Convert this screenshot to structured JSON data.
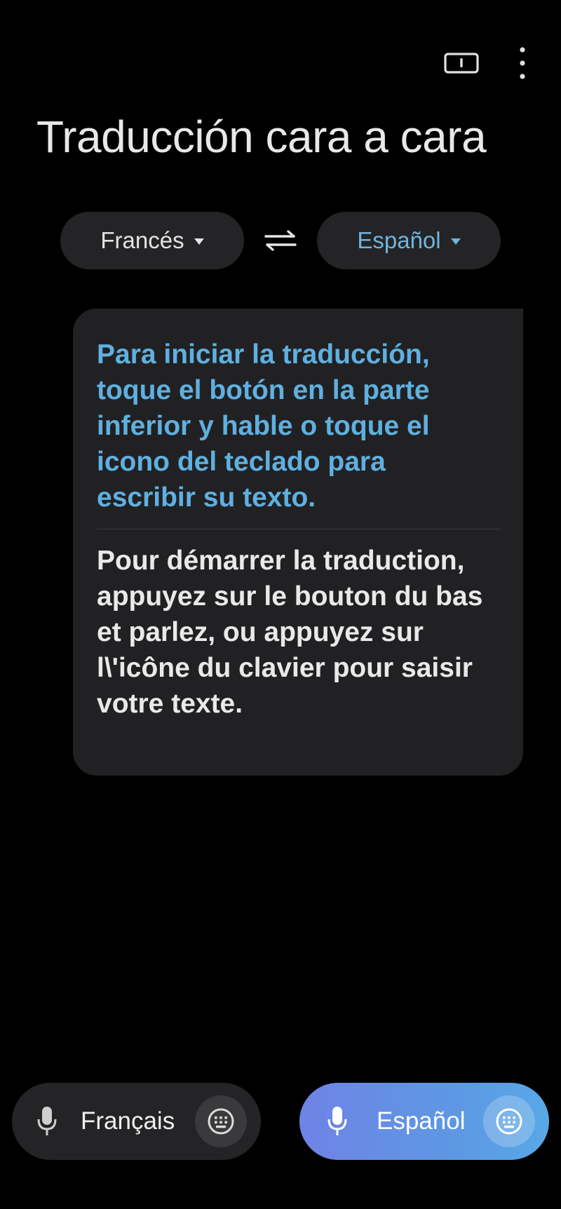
{
  "header": {
    "title": "Traducción cara a cara",
    "icons": [
      "conversation-mode-icon",
      "more-vert-icon"
    ]
  },
  "languages": {
    "source": "Francés",
    "target": "Español",
    "swap_icon": "swap-arrows-icon"
  },
  "card": {
    "instruction_es": "Para iniciar la traducción, toque el botón en la parte inferior y hable o toque el icono del teclado para escribir su texto.",
    "instruction_fr": "Pour démarrer la traduction, appuyez sur le bouton du bas et parlez, ou appuyez sur l\\'icône du clavier pour saisir votre texte."
  },
  "bottom": {
    "left_label": "Français",
    "right_label": "Español",
    "mic_icon": "microphone-icon",
    "keyboard_icon": "keyboard-icon"
  },
  "colors": {
    "background": "#000000",
    "accent_blue": "#5fb0e0",
    "card_bg": "#212123",
    "pill_bg": "#242426",
    "active_gradient_start": "#6f83e6",
    "active_gradient_end": "#58a8e6"
  }
}
